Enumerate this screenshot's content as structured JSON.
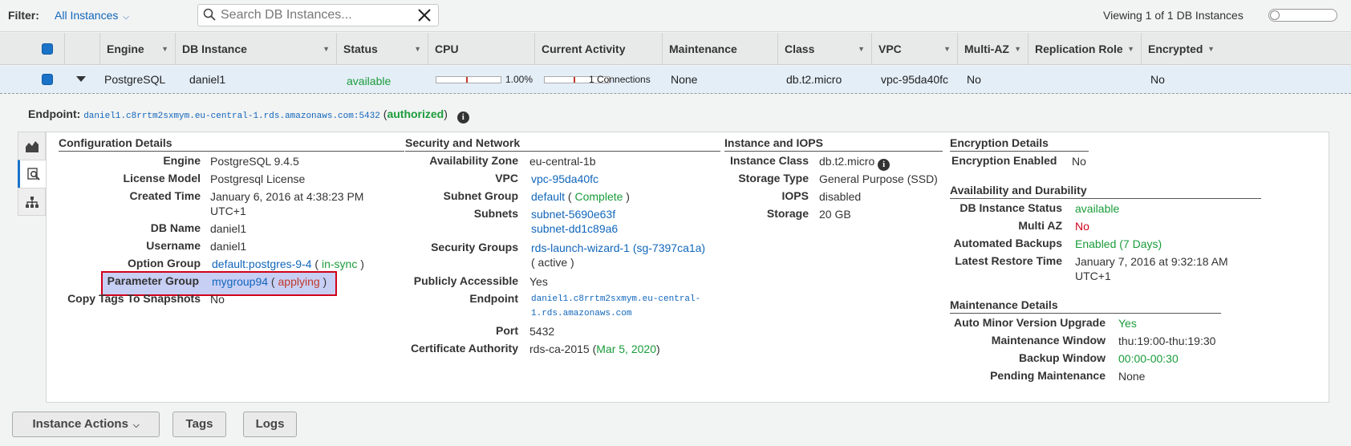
{
  "filterbar": {
    "filter_label": "Filter:",
    "filter_value": "All Instances",
    "search_placeholder": "Search DB Instances...",
    "viewing_text": "Viewing 1 of 1 DB Instances"
  },
  "table": {
    "columns": [
      "Engine",
      "DB Instance",
      "Status",
      "CPU",
      "Current Activity",
      "Maintenance",
      "Class",
      "VPC",
      "Multi-AZ",
      "Replication Role",
      "Encrypted"
    ],
    "row": {
      "engine": "PostgreSQL",
      "db_instance": "daniel1",
      "status": "available",
      "cpu": "1.00%",
      "cpu_fraction": 0.01,
      "activity": "1 Connections",
      "maintenance": "None",
      "class": "db.t2.micro",
      "vpc": "vpc-95da40fc",
      "multi_az": "No",
      "replication_role": "",
      "encrypted": "No"
    }
  },
  "endpoint": {
    "label": "Endpoint:",
    "value": "daniel1.c8rrtm2sxmym.eu-central-1.rds.amazonaws.com:5432",
    "status_open": "(",
    "status": "authorized",
    "status_close": ")"
  },
  "config": {
    "title": "Configuration Details",
    "engine_label": "Engine",
    "engine": "PostgreSQL 9.4.5",
    "license_label": "License Model",
    "license": "Postgresql License",
    "created_label": "Created Time",
    "created_1": "January 6, 2016 at 4:38:23 PM",
    "created_2": "UTC+1",
    "dbname_label": "DB Name",
    "dbname": "daniel1",
    "username_label": "Username",
    "username": "daniel1",
    "option_label": "Option Group",
    "option": "default:postgres-9-4",
    "option_status": "in-sync",
    "param_label": "Parameter Group",
    "param": "mygroup94",
    "param_status": "applying",
    "copytags_label": "Copy Tags To Snapshots",
    "copytags": "No"
  },
  "security": {
    "title": "Security and Network",
    "az_label": "Availability Zone",
    "az": "eu-central-1b",
    "vpc_label": "VPC",
    "vpc": "vpc-95da40fc",
    "subnetgroup_label": "Subnet Group",
    "subnetgroup": "default",
    "subnetgroup_status": "Complete",
    "subnets_label": "Subnets",
    "subnet_1": "subnet-5690e63f",
    "subnet_2": "subnet-dd1c89a6",
    "sg_label": "Security Groups",
    "sg": "rds-launch-wizard-1 (sg-7397ca1a)",
    "sg_status": "( active )",
    "public_label": "Publicly Accessible",
    "public": "Yes",
    "endpoint_label": "Endpoint",
    "endpoint_1": "daniel1.c8rrtm2sxmym.eu-central-",
    "endpoint_2": "1.rds.amazonaws.com",
    "port_label": "Port",
    "port": "5432",
    "ca_label": "Certificate Authority",
    "ca": "rds-ca-2015",
    "ca_date": "Mar 5, 2020"
  },
  "iops": {
    "title": "Instance and IOPS",
    "class_label": "Instance Class",
    "class": "db.t2.micro",
    "storage_type_label": "Storage Type",
    "storage_type": "General Purpose (SSD)",
    "iops_label": "IOPS",
    "iops": "disabled",
    "storage_label": "Storage",
    "storage": "20 GB"
  },
  "encryption": {
    "title": "Encryption Details",
    "enabled_label": "Encryption Enabled",
    "enabled": "No"
  },
  "availability": {
    "title": "Availability and Durability",
    "status_label": "DB Instance Status",
    "status": "available",
    "multiaz_label": "Multi AZ",
    "multiaz": "No",
    "backups_label": "Automated Backups",
    "backups": "Enabled (7 Days)",
    "restore_label": "Latest Restore Time",
    "restore_1": "January 7, 2016 at 9:32:18 AM",
    "restore_2": "UTC+1"
  },
  "maintenance": {
    "title": "Maintenance Details",
    "autominor_label": "Auto Minor Version Upgrade",
    "autominor": "Yes",
    "window_label": "Maintenance Window",
    "window": "thu:19:00-thu:19:30",
    "backup_window_label": "Backup Window",
    "backup_window": "00:00-00:30",
    "pending_label": "Pending Maintenance",
    "pending": "None"
  },
  "buttons": {
    "instance_actions": "Instance Actions",
    "tags": "Tags",
    "logs": "Logs"
  },
  "colors": {
    "link": "#1166bb",
    "ok": "#1a9c3a",
    "error": "#d0021b",
    "highlight": "#c8cff5"
  }
}
